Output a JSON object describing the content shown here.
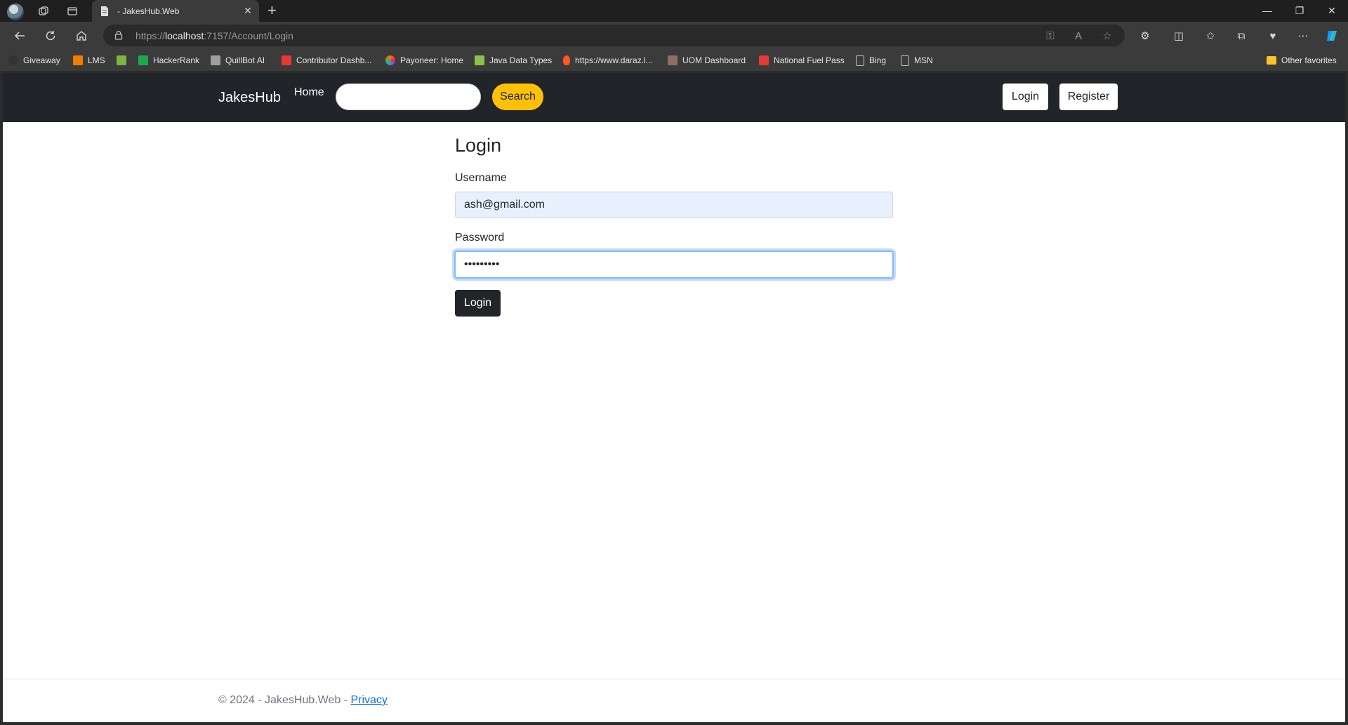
{
  "browser": {
    "tab_title": "- JakesHub.Web",
    "url_scheme": "https://",
    "url_host": "localhost",
    "url_path": ":7157/Account/Login",
    "favorites": [
      {
        "label": "Giveaway",
        "color": "#333333"
      },
      {
        "label": "LMS",
        "color": "#f57c00"
      },
      {
        "label": "",
        "color": "#7cb342"
      },
      {
        "label": "HackerRank",
        "color": "#1ba94c"
      },
      {
        "label": "QuillBot AI",
        "color": "#9e9e9e"
      },
      {
        "label": "Contributor Dashb...",
        "color": "#e53935"
      },
      {
        "label": "Payoneer: Home",
        "color": "#ff6f00"
      },
      {
        "label": "Java Data Types",
        "color": "#8bc34a"
      },
      {
        "label": "https://www.daraz.l...",
        "color": "#ff5722"
      },
      {
        "label": "UOM Dashboard",
        "color": "#8d6e63"
      },
      {
        "label": "National Fuel Pass",
        "color": "#e53935"
      },
      {
        "label": "Bing",
        "color": "#bdbdbd"
      },
      {
        "label": "MSN",
        "color": "#bdbdbd"
      }
    ],
    "other_favorites": "Other favorites"
  },
  "navbar": {
    "brand": "JakesHub",
    "home": "Home",
    "search_value": "",
    "search_button": "Search",
    "login": "Login",
    "register": "Register",
    "accent_color": "#ffc107"
  },
  "login_form": {
    "title": "Login",
    "username_label": "Username",
    "username_value": "ash@gmail.com",
    "password_label": "Password",
    "password_value": "•••••••••",
    "submit": "Login"
  },
  "footer": {
    "text": "© 2024 - JakesHub.Web - ",
    "privacy": "Privacy"
  }
}
